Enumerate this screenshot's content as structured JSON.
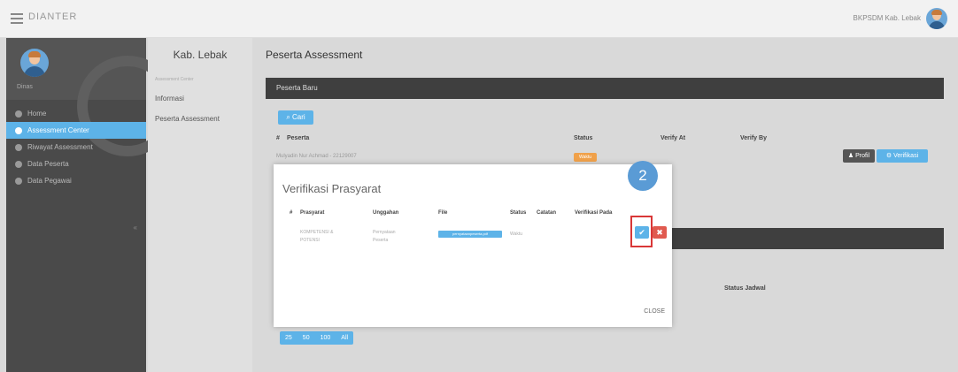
{
  "header": {
    "brand": "DIANTER",
    "user_name": "BKPSDM Kab. Lebak"
  },
  "sidebar": {
    "role": "Dinas",
    "items": [
      {
        "label": "Home"
      },
      {
        "label": "Assessment Center"
      },
      {
        "label": "Riwayat Assessment"
      },
      {
        "label": "Data Peserta"
      },
      {
        "label": "Data Pegawai"
      }
    ],
    "collapse": "«"
  },
  "subnav": {
    "title": "Kab. Lebak",
    "small_label": "Assessment Center",
    "items": [
      {
        "label": "Informasi"
      },
      {
        "label": "Peserta Assessment"
      }
    ]
  },
  "main": {
    "page_title": "Peserta Assessment",
    "panel_title": "Peserta Baru",
    "search_label": "Cari",
    "table_headers": {
      "num": "#",
      "peserta": "Peserta",
      "status": "Status",
      "verify_at": "Verify At",
      "verify_by": "Verify By"
    },
    "row": {
      "name": "Mulyadin Nur Achmad - 22129007",
      "status": "Waktu"
    },
    "profil_label": "Profil",
    "verifikasi_label": "Verifikasi",
    "status_jadwal": "Status Jadwal",
    "pager": [
      "25",
      "50",
      "100",
      "All"
    ]
  },
  "modal": {
    "title": "Verifikasi Prasyarat",
    "headers": {
      "num": "#",
      "prasyarat": "Prasyarat",
      "unggahan": "Unggahan",
      "file": "File",
      "status": "Status",
      "catatan": "Catatan",
      "verifikasi_pada": "Verifikasi Pada"
    },
    "row": {
      "prasyarat_1": "KOMPETENSI &",
      "prasyarat_2": "POTENSI",
      "unggahan_1": "Pernyataan",
      "unggahan_2": "Peserta",
      "file": "pernyataanpeserta.pdf",
      "status": "Waktu"
    },
    "check_label": "✔",
    "reject_label": "✖",
    "close_label": "CLOSE",
    "step_number": "2"
  },
  "colors": {
    "accent": "#5db3e8",
    "dark": "#3f3f3f",
    "danger": "#e05a4f",
    "highlight": "#d93737",
    "step": "#5a9bd5",
    "warning": "#f0a14a"
  }
}
